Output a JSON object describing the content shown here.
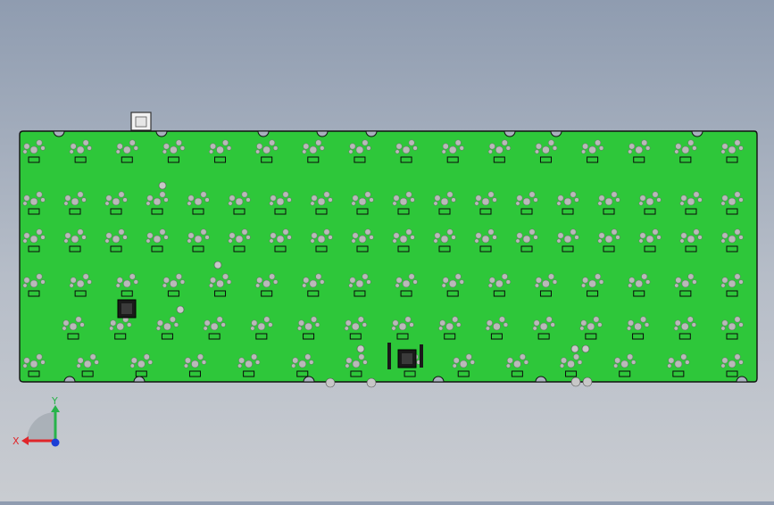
{
  "viewport": {
    "background_top": "#8f9cb0",
    "background_bottom": "#c9ccd1"
  },
  "pcb": {
    "board_color": "#2ec73a",
    "edge_color": "#111111",
    "pad_color": "#b9b9b9",
    "label_color": "#0a0a0a",
    "connector": "usb-c-connector",
    "rows": [
      {
        "name": "row-1",
        "keys": 16
      },
      {
        "name": "row-2",
        "keys": 18
      },
      {
        "name": "row-3",
        "keys": 18
      },
      {
        "name": "row-4",
        "keys": 16
      },
      {
        "name": "row-5",
        "keys": 15
      },
      {
        "name": "row-6",
        "keys": 14
      }
    ]
  },
  "triad": {
    "x_label": "X",
    "y_label": "Y",
    "x_color": "#e0262b",
    "y_color": "#27b34a",
    "z_color": "#1c3fd6"
  }
}
